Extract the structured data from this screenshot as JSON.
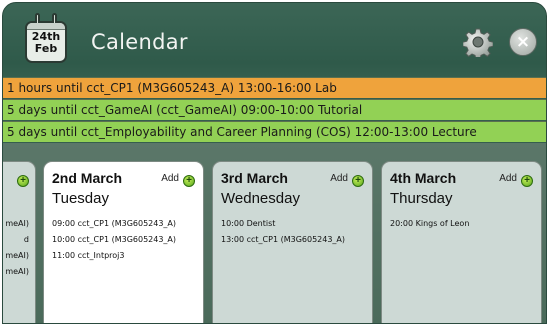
{
  "header": {
    "title": "Calendar",
    "date_day": "24th",
    "date_month": "Feb",
    "close_glyph": "×",
    "settings_icon": "gear-icon",
    "close_icon": "close-icon"
  },
  "alerts": [
    {
      "text": "1 hours until cct_CP1 (M3G605243_A) 13:00-16:00 Lab",
      "color": "#efa33c"
    },
    {
      "text": "5 days until cct_GameAI (cct_GameAI) 09:00-10:00 Tutorial",
      "color": "#92d155"
    },
    {
      "text": "5 days until cct_Employability and Career Planning (COS) 12:00-13:00 Lecture",
      "color": "#92d155"
    }
  ],
  "days": {
    "partial": {
      "events": [
        "meAI)",
        "d",
        "meAI)",
        "meAI)"
      ]
    },
    "d2": {
      "date": "2nd March",
      "weekday": "Tuesday",
      "add_label": "Add",
      "events": [
        "09:00 cct_CP1 (M3G605243_A)",
        "10:00 cct_CP1 (M3G605243_A)",
        "11:00 cct_Intproj3"
      ]
    },
    "d3": {
      "date": "3rd March",
      "weekday": "Wednesday",
      "add_label": "Add",
      "events": [
        "10:00 Dentist",
        "13:00 cct_CP1 (M3G605243_A)"
      ]
    },
    "d4": {
      "date": "4th March",
      "weekday": "Thursday",
      "add_label": "Add",
      "events": [
        "20:00 Kings of Leon"
      ]
    }
  }
}
